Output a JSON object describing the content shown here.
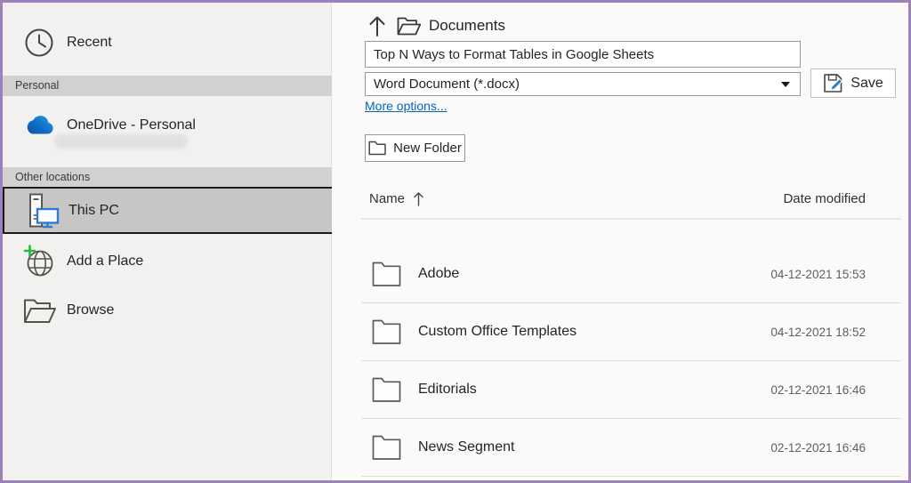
{
  "colors": {
    "window_border": "#9b82b8",
    "accent_link": "#0563c1",
    "onedrive_blue": "#0078d4",
    "pc_monitor_blue": "#2b7cd3",
    "add_place_green": "#2db83d",
    "selected_item_bg": "#c8c6c4"
  },
  "sidebar": {
    "section_headers": [
      "Personal",
      "Other locations"
    ],
    "items": [
      {
        "label": "Recent",
        "icon": "clock-icon"
      },
      {
        "label": "OneDrive - Personal",
        "icon": "onedrive-icon"
      },
      {
        "label": "This PC",
        "icon": "this-pc-icon",
        "selected": true
      },
      {
        "label": "Add a Place",
        "icon": "add-place-icon"
      },
      {
        "label": "Browse",
        "icon": "browse-icon"
      }
    ]
  },
  "save_bar": {
    "breadcrumb": "Documents",
    "filename_value": "Top N Ways to Format Tables in Google Sheets",
    "filetype_value": "Word Document (*.docx)",
    "save_label": "Save",
    "more_options_label": "More options...",
    "new_folder_label": "New Folder"
  },
  "file_list": {
    "name_column": "Name",
    "date_column": "Date modified",
    "sort": "name-ascending",
    "rows": [
      {
        "name": "Adobe",
        "date_modified": "04-12-2021 15:53"
      },
      {
        "name": "Custom Office Templates",
        "date_modified": "04-12-2021 18:52"
      },
      {
        "name": "Editorials",
        "date_modified": "02-12-2021 16:46"
      },
      {
        "name": "News Segment",
        "date_modified": "02-12-2021 16:46"
      }
    ]
  }
}
